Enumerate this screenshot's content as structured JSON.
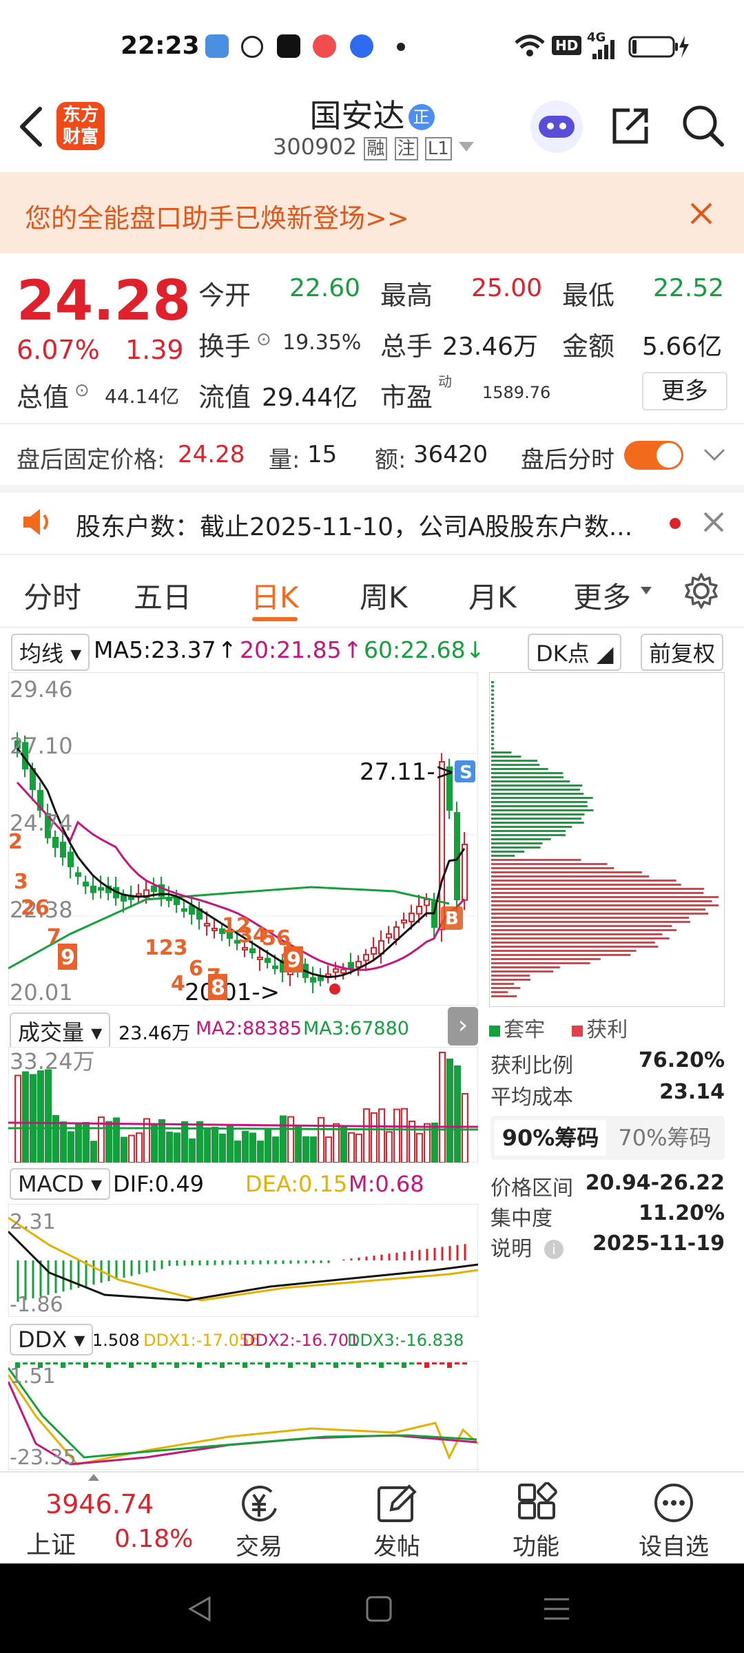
{
  "status_bar": {
    "time": "22:23",
    "network": "4G"
  },
  "header": {
    "logo_text": "东方财富",
    "stock_name": "国安达",
    "badge": "正",
    "stock_code": "300902",
    "tags": [
      "融",
      "注",
      "L1"
    ]
  },
  "banner": {
    "text": "您的全能盘口助手已焕新登场>>"
  },
  "quote": {
    "price": "24.28",
    "change_pct": "6.07%",
    "change": "1.39",
    "open_label": "今开",
    "open": "22.60",
    "high_label": "最高",
    "high": "25.00",
    "low_label": "最低",
    "low": "22.52",
    "turnover_label": "换手",
    "turnover": "19.35%",
    "volume_label": "总手",
    "volume": "23.46万",
    "amount_label": "金额",
    "amount": "5.66亿",
    "mcap_label": "总值",
    "mcap": "44.14亿",
    "float_label": "流值",
    "float": "29.44亿",
    "pe_label": "市盈",
    "pe_sup": "动",
    "pe": "1589.76",
    "more_label": "更多"
  },
  "after_hours": {
    "price_label": "盘后固定价格:",
    "price": "24.28",
    "vol_label": "量:",
    "vol": "15",
    "amt_label": "额:",
    "amt": "36420",
    "toggle_label": "盘后分时"
  },
  "notice": {
    "text": "股东户数：截止2025-11-10，公司A股股东户数..."
  },
  "tabs": [
    "分时",
    "五日",
    "日K",
    "周K",
    "月K",
    "更多"
  ],
  "active_tab": "日K",
  "kline": {
    "ma_selector": "均线",
    "ma5": "MA5:23.37",
    "ma20": "20:21.85",
    "ma60": "60:22.68",
    "dk_label": "DK点",
    "adjust_label": "前复权",
    "y_labels": [
      "29.46",
      "27.10",
      "24.74",
      "22.38",
      "20.01"
    ],
    "high_marker": "27.11->",
    "low_marker": "20.01->",
    "s_marker": "S",
    "b_marker": "B",
    "nine_marker": "9",
    "seq_labels": [
      "2",
      "3",
      "26",
      "7",
      "9",
      "123",
      "4",
      "6",
      "7",
      "12",
      "34",
      "56",
      "7",
      "9",
      "8"
    ],
    "colors": {
      "ma5": "#111111",
      "ma20": "#c8157c",
      "ma60": "#14a03c",
      "up": "#e0202a",
      "down": "#14a03c"
    }
  },
  "volume": {
    "selector": "成交量",
    "value": "23.46万",
    "ma2": "MA2:88385",
    "ma3": "MA3:67880",
    "y_label": "33.24万"
  },
  "macd": {
    "selector": "MACD",
    "dif": "DIF:0.49",
    "dea": "DEA:0.15",
    "m": "M:0.68",
    "y_top": "2.31",
    "y_bottom": "-1.86"
  },
  "ddx": {
    "selector": "DDX",
    "value": "1.508",
    "ddx1": "DDX1:-17.056",
    "ddx2": "DDX2:-16.701",
    "ddx3": "DDX3:-16.838",
    "y_top": "1.51",
    "y_bottom": "-23.35"
  },
  "chip_dist": {
    "legend_trapped": "套牢",
    "legend_profit": "获利",
    "profit_ratio_label": "获利比例",
    "profit_ratio": "76.20%",
    "avg_cost_label": "平均成本",
    "avg_cost": "23.14",
    "tab_90": "90%筹码",
    "tab_70": "70%筹码",
    "range_label": "价格区间",
    "range": "20.94-26.22",
    "concentration_label": "集中度",
    "concentration": "11.20%",
    "note_label": "说明",
    "date": "2025-11-19"
  },
  "bottom_nav": {
    "index_value": "3946.74",
    "index_name": "上证",
    "index_change": "0.18%",
    "items": [
      "交易",
      "发帖",
      "功能",
      "设自选"
    ]
  }
}
